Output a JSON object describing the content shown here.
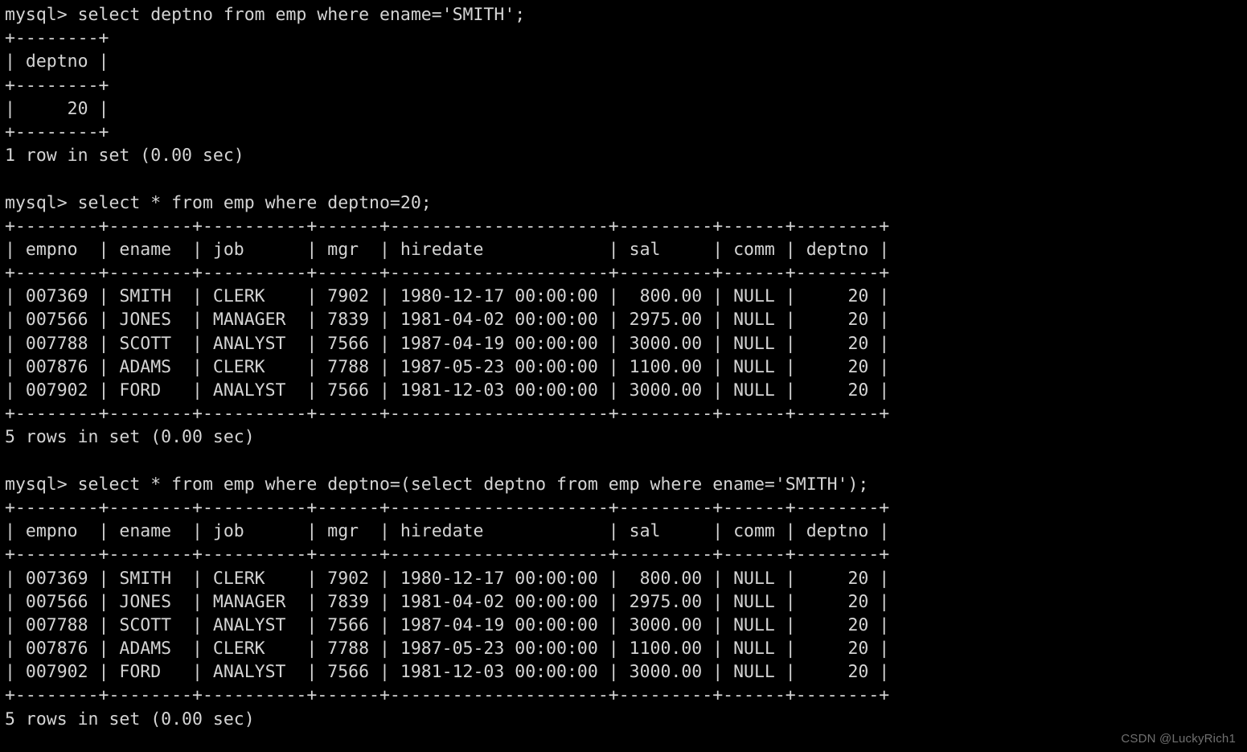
{
  "terminal": {
    "app": "mysql-client",
    "prompt": "mysql>",
    "background_color": "#000000",
    "text_color": "#d4d4d4",
    "lines": [
      "mysql> select deptno from emp where ename='SMITH';",
      "+--------+",
      "| deptno |",
      "+--------+",
      "|     20 |",
      "+--------+",
      "1 row in set (0.00 sec)",
      "",
      "mysql> select * from emp where deptno=20;",
      "+--------+--------+----------+------+---------------------+---------+------+--------+",
      "| empno  | ename  | job      | mgr  | hiredate            | sal     | comm | deptno |",
      "+--------+--------+----------+------+---------------------+---------+------+--------+",
      "| 007369 | SMITH  | CLERK    | 7902 | 1980-12-17 00:00:00 |  800.00 | NULL |     20 |",
      "| 007566 | JONES  | MANAGER  | 7839 | 1981-04-02 00:00:00 | 2975.00 | NULL |     20 |",
      "| 007788 | SCOTT  | ANALYST  | 7566 | 1987-04-19 00:00:00 | 3000.00 | NULL |     20 |",
      "| 007876 | ADAMS  | CLERK    | 7788 | 1987-05-23 00:00:00 | 1100.00 | NULL |     20 |",
      "| 007902 | FORD   | ANALYST  | 7566 | 1981-12-03 00:00:00 | 3000.00 | NULL |     20 |",
      "+--------+--------+----------+------+---------------------+---------+------+--------+",
      "5 rows in set (0.00 sec)",
      "",
      "mysql> select * from emp where deptno=(select deptno from emp where ename='SMITH');",
      "+--------+--------+----------+------+---------------------+---------+------+--------+",
      "| empno  | ename  | job      | mgr  | hiredate            | sal     | comm | deptno |",
      "+--------+--------+----------+------+---------------------+---------+------+--------+",
      "| 007369 | SMITH  | CLERK    | 7902 | 1980-12-17 00:00:00 |  800.00 | NULL |     20 |",
      "| 007566 | JONES  | MANAGER  | 7839 | 1981-04-02 00:00:00 | 2975.00 | NULL |     20 |",
      "| 007788 | SCOTT  | ANALYST  | 7566 | 1987-04-19 00:00:00 | 3000.00 | NULL |     20 |",
      "| 007876 | ADAMS  | CLERK    | 7788 | 1987-05-23 00:00:00 | 1100.00 | NULL |     20 |",
      "| 007902 | FORD   | ANALYST  | 7566 | 1981-12-03 00:00:00 | 3000.00 | NULL |     20 |",
      "+--------+--------+----------+------+---------------------+---------+------+--------+",
      "5 rows in set (0.00 sec)"
    ],
    "queries": [
      {
        "sql": "select deptno from emp where ename='SMITH';",
        "columns": [
          "deptno"
        ],
        "rows": [
          [
            "20"
          ]
        ],
        "status": "1 row in set (0.00 sec)"
      },
      {
        "sql": "select * from emp where deptno=20;",
        "columns": [
          "empno",
          "ename",
          "job",
          "mgr",
          "hiredate",
          "sal",
          "comm",
          "deptno"
        ],
        "rows": [
          [
            "007369",
            "SMITH",
            "CLERK",
            "7902",
            "1980-12-17 00:00:00",
            "800.00",
            "NULL",
            "20"
          ],
          [
            "007566",
            "JONES",
            "MANAGER",
            "7839",
            "1981-04-02 00:00:00",
            "2975.00",
            "NULL",
            "20"
          ],
          [
            "007788",
            "SCOTT",
            "ANALYST",
            "7566",
            "1987-04-19 00:00:00",
            "3000.00",
            "NULL",
            "20"
          ],
          [
            "007876",
            "ADAMS",
            "CLERK",
            "7788",
            "1987-05-23 00:00:00",
            "1100.00",
            "NULL",
            "20"
          ],
          [
            "007902",
            "FORD",
            "ANALYST",
            "7566",
            "1981-12-03 00:00:00",
            "3000.00",
            "NULL",
            "20"
          ]
        ],
        "status": "5 rows in set (0.00 sec)"
      },
      {
        "sql": "select * from emp where deptno=(select deptno from emp where ename='SMITH');",
        "columns": [
          "empno",
          "ename",
          "job",
          "mgr",
          "hiredate",
          "sal",
          "comm",
          "deptno"
        ],
        "rows": [
          [
            "007369",
            "SMITH",
            "CLERK",
            "7902",
            "1980-12-17 00:00:00",
            "800.00",
            "NULL",
            "20"
          ],
          [
            "007566",
            "JONES",
            "MANAGER",
            "7839",
            "1981-04-02 00:00:00",
            "2975.00",
            "NULL",
            "20"
          ],
          [
            "007788",
            "SCOTT",
            "ANALYST",
            "7566",
            "1987-04-19 00:00:00",
            "3000.00",
            "NULL",
            "20"
          ],
          [
            "007876",
            "ADAMS",
            "CLERK",
            "7788",
            "1987-05-23 00:00:00",
            "1100.00",
            "NULL",
            "20"
          ],
          [
            "007902",
            "FORD",
            "ANALYST",
            "7566",
            "1981-12-03 00:00:00",
            "3000.00",
            "NULL",
            "20"
          ]
        ],
        "status": "5 rows in set (0.00 sec)"
      }
    ]
  },
  "watermark": {
    "text": "CSDN @LuckyRich1",
    "color": "#707070"
  }
}
